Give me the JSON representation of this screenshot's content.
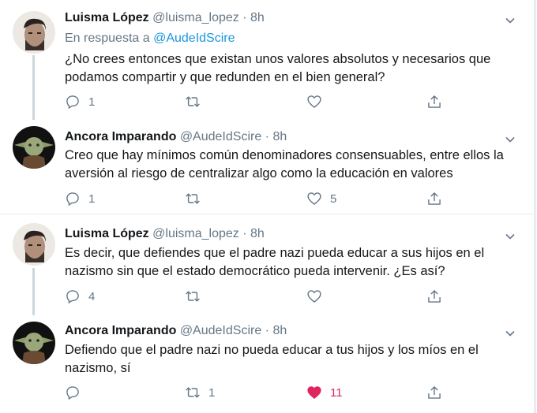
{
  "tweets": [
    {
      "author": "Luisma López",
      "handle": "@luisma_lopez",
      "dot": "·",
      "time": "8h",
      "reply_prefix": "En respuesta a",
      "reply_handle": "@AudeIdScire",
      "text_line1": "¿No crees entonces que existan unos valores absolutos y necesarios que",
      "text_line2": "podamos compartir y que redunden en el bien general?",
      "replies": "1",
      "retweets": "",
      "likes": "",
      "liked": false
    },
    {
      "author": "Ancora Imparando",
      "handle": "@AudeIdScire",
      "dot": "·",
      "time": "8h",
      "text_line1": "Creo que hay mínimos común denominadores consensuables, entre ellos la",
      "text_line2": "aversión al riesgo de centralizar algo como la educación en valores",
      "replies": "1",
      "retweets": "",
      "likes": "5",
      "liked": false
    },
    {
      "author": "Luisma López",
      "handle": "@luisma_lopez",
      "dot": "·",
      "time": "8h",
      "text_line1": "Es decir, que defiendes que el padre nazi pueda educar a sus hijos en el",
      "text_line2": "nazismo sin que el estado democrático pueda intervenir. ¿Es así?",
      "replies": "4",
      "retweets": "",
      "likes": "",
      "liked": false
    },
    {
      "author": "Ancora Imparando",
      "handle": "@AudeIdScire",
      "dot": "·",
      "time": "8h",
      "text_line1": "Defiendo que el padre nazi no pueda educar a tus hijos y los míos en el",
      "text_line2": "nazismo, sí",
      "replies": "",
      "retweets": "1",
      "likes": "11",
      "liked": true
    }
  ],
  "colors": {
    "name": "#14171a",
    "meta": "#657786",
    "link": "#1b95e0",
    "like_active": "#e0245e",
    "divider": "#e6ecf0",
    "thread_line": "#ccd6dd"
  },
  "icons": [
    "chevron-down-icon",
    "reply-icon",
    "retweet-icon",
    "heart-icon",
    "share-icon"
  ]
}
